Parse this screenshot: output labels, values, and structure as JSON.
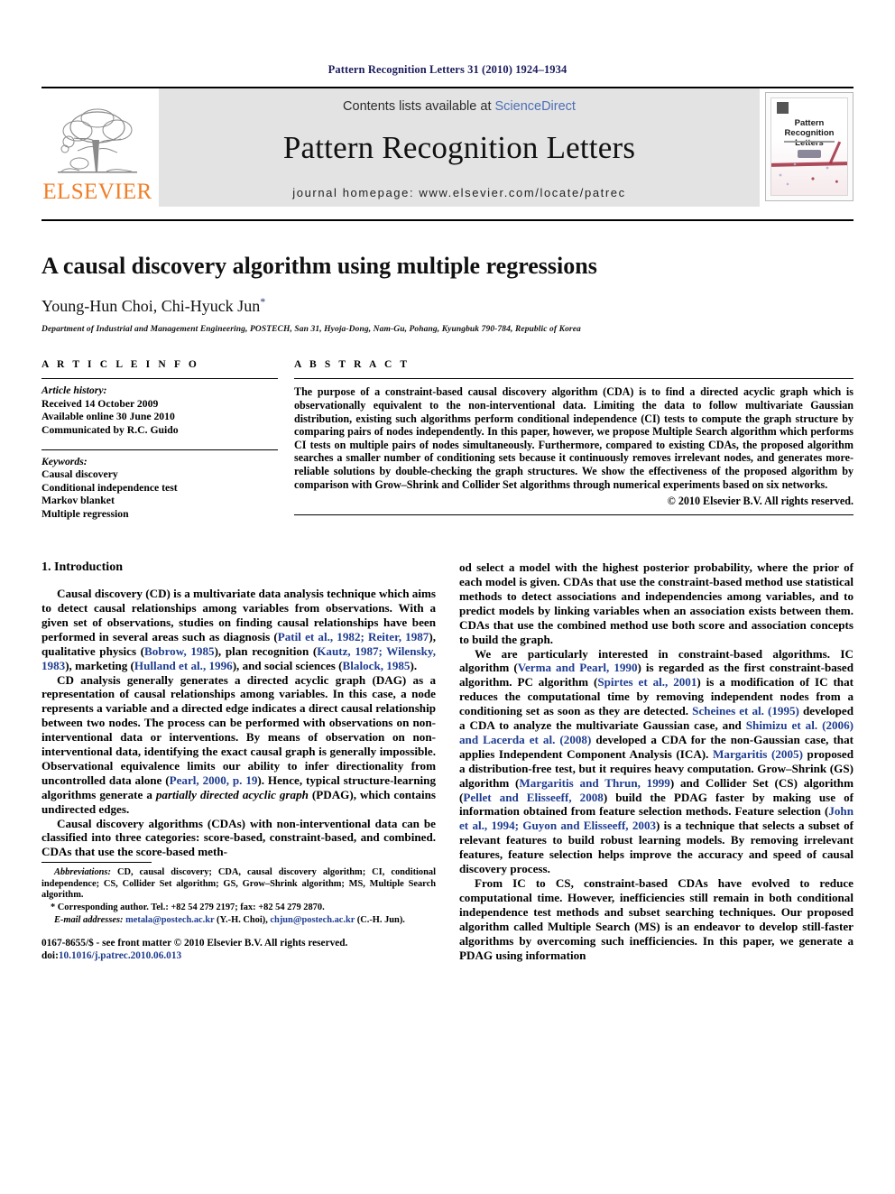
{
  "running_head": "Pattern Recognition Letters 31 (2010) 1924–1934",
  "masthead": {
    "publisher_name": "ELSEVIER",
    "contents_prefix": "Contents lists available at ",
    "sciencedirect": "ScienceDirect",
    "journal_title": "Pattern Recognition Letters",
    "homepage": "journal homepage: www.elsevier.com/locate/patrec",
    "cover": {
      "title_line1": "Pattern Recognition",
      "title_line2": "Letters"
    },
    "accent_orange": "#f07e26",
    "band_gray": "#e3e3e3",
    "link_blue": "#4d6fb5"
  },
  "article": {
    "title": "A causal discovery algorithm using multiple regressions",
    "authors": "Young-Hun Choi, Chi-Hyuck Jun",
    "corresponding_marker": "*",
    "affiliation": "Department of Industrial and Management Engineering, POSTECH, San 31, Hyoja-Dong, Nam-Gu, Pohang, Kyungbuk 790-784, Republic of Korea"
  },
  "info": {
    "heading": "A R T I C L E   I N F O",
    "history_label": "Article history:",
    "history": [
      "Received 14 October 2009",
      "Available online 30 June 2010",
      "Communicated by R.C. Guido"
    ],
    "keywords_label": "Keywords:",
    "keywords": [
      "Causal discovery",
      "Conditional independence test",
      "Markov blanket",
      "Multiple regression"
    ]
  },
  "abstract": {
    "heading": "A B S T R A C T",
    "text": "The purpose of a constraint-based causal discovery algorithm (CDA) is to find a directed acyclic graph which is observationally equivalent to the non-interventional data. Limiting the data to follow multivariate Gaussian distribution, existing such algorithms perform conditional independence (CI) tests to compute the graph structure by comparing pairs of nodes independently. In this paper, however, we propose Multiple Search algorithm which performs CI tests on multiple pairs of nodes simultaneously. Furthermore, compared to existing CDAs, the proposed algorithm searches a smaller number of conditioning sets because it continuously removes irrelevant nodes, and generates more-reliable solutions by double-checking the graph structures. We show the effectiveness of the proposed algorithm by comparison with Grow–Shrink and Collider Set algorithms through numerical experiments based on six networks.",
    "copyright": "© 2010 Elsevier B.V. All rights reserved."
  },
  "body": {
    "section_heading": "1. Introduction",
    "left_paragraphs": [
      [
        {
          "t": "Causal discovery (CD) is a multivariate data analysis technique which aims to detect causal relationships among variables from observations. With a given set of observations, studies on finding causal relationships have been performed in several areas such as diagnosis ("
        },
        {
          "t": "Patil et al., 1982; Reiter, 1987",
          "c": true
        },
        {
          "t": "), qualitative physics ("
        },
        {
          "t": "Bobrow, 1985",
          "c": true
        },
        {
          "t": "), plan recognition ("
        },
        {
          "t": "Kautz, 1987; Wilensky, 1983",
          "c": true
        },
        {
          "t": "), marketing ("
        },
        {
          "t": "Hulland et al., 1996",
          "c": true
        },
        {
          "t": "), and social sciences ("
        },
        {
          "t": "Blalock, 1985",
          "c": true
        },
        {
          "t": ")."
        }
      ],
      [
        {
          "t": "CD analysis generally generates a directed acyclic graph (DAG) as a representation of causal relationships among variables. In this case, a node represents a variable and a directed edge indicates a direct causal relationship between two nodes. The process can be performed with observations on non-interventional data or interventions. By means of observation on non-interventional data, identifying the exact causal graph is generally impossible. Observational equivalence limits our ability to infer directionality from uncontrolled data alone ("
        },
        {
          "t": "Pearl, 2000, p. 19",
          "c": true
        },
        {
          "t": "). Hence, typical structure-learning algorithms generate a "
        },
        {
          "t": "partially directed acyclic graph",
          "i": true
        },
        {
          "t": " (PDAG), which contains undirected edges."
        }
      ],
      [
        {
          "t": "Causal discovery algorithms (CDAs) with non-interventional data can be classified into three categories: score-based, constraint-based, and combined. CDAs that use the score-based meth-"
        }
      ]
    ],
    "right_paragraphs": [
      [
        {
          "t": "od select a model with the highest posterior probability, where the prior of each model is given. CDAs that use the constraint-based method use statistical methods to detect associations and independencies among variables, and to predict models by linking variables when an association exists between them. CDAs that use the combined method use both score and association concepts to build the graph."
        }
      ],
      [
        {
          "t": "We are particularly interested in constraint-based algorithms. IC algorithm ("
        },
        {
          "t": "Verma and Pearl, 1990",
          "c": true
        },
        {
          "t": ") is regarded as the first constraint-based algorithm. PC algorithm ("
        },
        {
          "t": "Spirtes et al., 2001",
          "c": true
        },
        {
          "t": ") is a modification of IC that reduces the computational time by removing independent nodes from a conditioning set as soon as they are detected. "
        },
        {
          "t": "Scheines et al. (1995)",
          "c": true
        },
        {
          "t": " developed a CDA to analyze the multivariate Gaussian case, and "
        },
        {
          "t": "Shimizu et al. (2006) and Lacerda et al. (2008)",
          "c": true
        },
        {
          "t": " developed a CDA for the non-Gaussian case, that applies Independent Component Analysis (ICA). "
        },
        {
          "t": "Margaritis (2005)",
          "c": true
        },
        {
          "t": " proposed a distribution-free test, but it requires heavy computation. Grow–Shrink (GS) algorithm ("
        },
        {
          "t": "Margaritis and Thrun, 1999",
          "c": true
        },
        {
          "t": ") and Collider Set (CS) algorithm ("
        },
        {
          "t": "Pellet and Elisseeff, 2008",
          "c": true
        },
        {
          "t": ") build the PDAG faster by making use of information obtained from feature selection methods. Feature selection ("
        },
        {
          "t": "John et al., 1994; Guyon and Elisseeff, 2003",
          "c": true
        },
        {
          "t": ") is a technique that selects a subset of relevant features to build robust learning models. By removing irrelevant features, feature selection helps improve the accuracy and speed of causal discovery process."
        }
      ],
      [
        {
          "t": "From IC to CS, constraint-based CDAs have evolved to reduce computational time. However, inefficiencies still remain in both conditional independence test methods and subset searching techniques. Our proposed algorithm called Multiple Search (MS) is an endeavor to develop still-faster algorithms by overcoming such inefficiencies. In this paper, we generate a PDAG using information"
        }
      ]
    ]
  },
  "footnotes": {
    "abbreviations_label": "Abbreviations:",
    "abbreviations_text": " CD, causal discovery; CDA, causal discovery algorithm; CI, conditional independence; CS, Collider Set algorithm; GS, Grow–Shrink algorithm; MS, Multiple Search algorithm.",
    "corresponding_marker": "*",
    "corresponding_text": " Corresponding author. Tel.: +82 54 279 2197; fax: +82 54 279 2870.",
    "email_label": "E-mail addresses:",
    "email1": "metala@postech.ac.kr",
    "email1_owner": " (Y.-H. Choi), ",
    "email2": "chjun@postech.ac.kr",
    "email2_owner": " (C.-H. Jun).",
    "issn_line": "0167-8655/$ - see front matter © 2010 Elsevier B.V. All rights reserved.",
    "doi_label": "doi:",
    "doi_value": "10.1016/j.patrec.2010.06.013",
    "link_blue": "#1f3d8f"
  }
}
